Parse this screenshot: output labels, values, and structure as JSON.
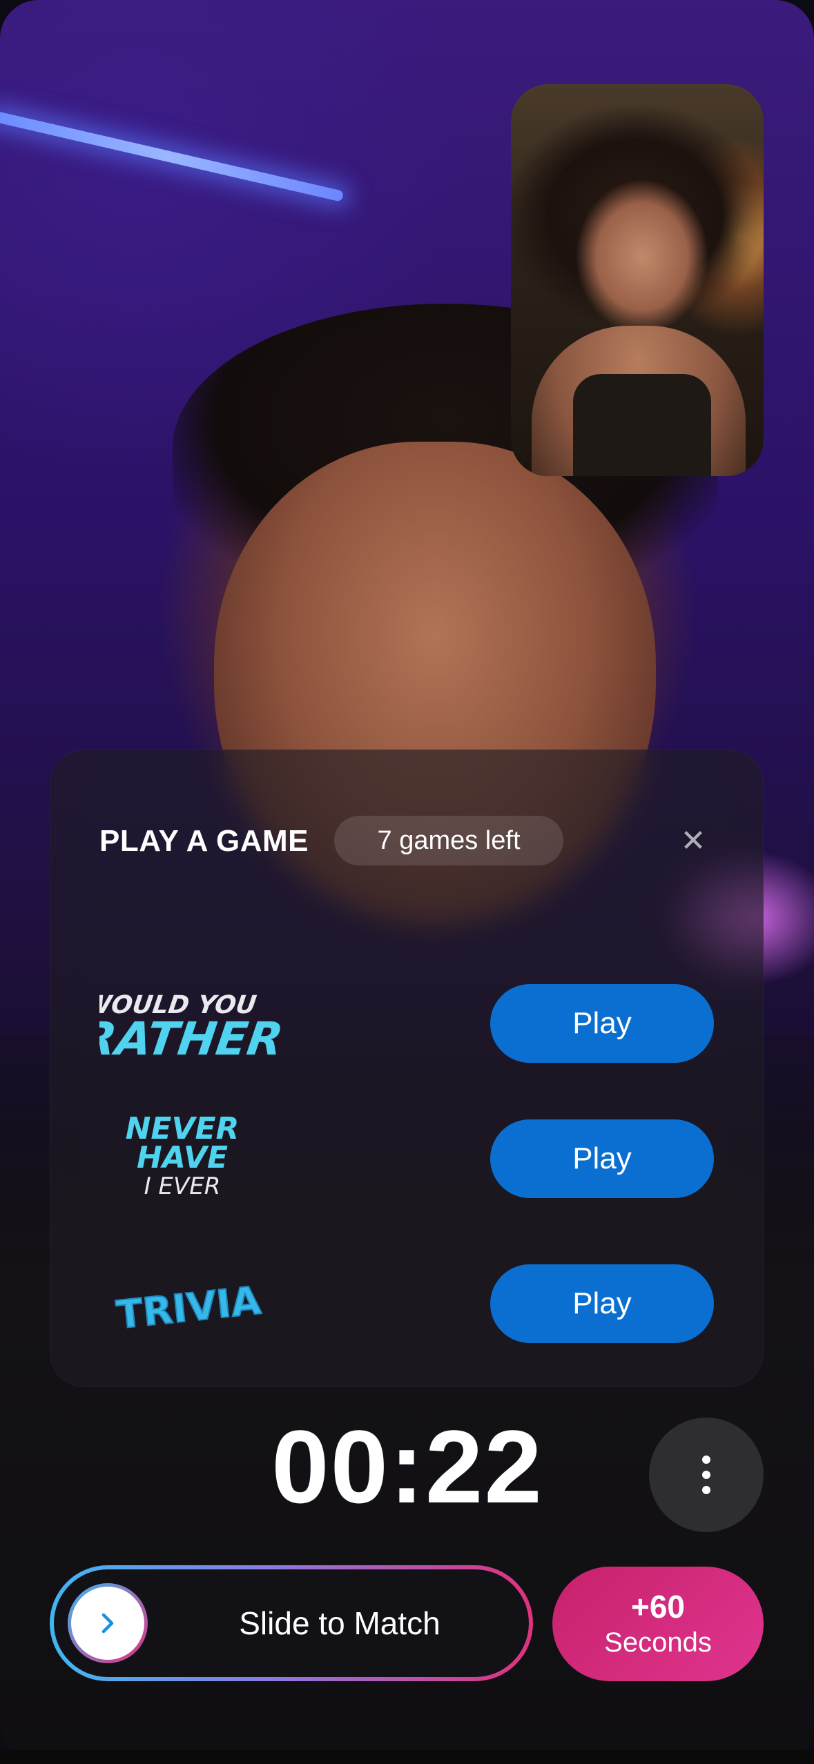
{
  "game_panel": {
    "title": "PLAY A GAME",
    "games_left": "7 games left",
    "close_icon": "close-icon",
    "games": [
      {
        "logo_lines": [
          "WOULD YOU",
          "RATHER"
        ],
        "play_label": "Play"
      },
      {
        "logo_lines": [
          "NEVER",
          "HAVE",
          "I EVER"
        ],
        "play_label": "Play"
      },
      {
        "logo_lines": [
          "TRIVIA"
        ],
        "play_label": "Play"
      }
    ]
  },
  "call": {
    "timer": "00:22",
    "more_icon": "more-vertical-icon"
  },
  "actions": {
    "slide_label": "Slide to Match",
    "slide_icon": "chevron-right-icon",
    "extend_amount": "+60",
    "extend_unit": "Seconds"
  },
  "colors": {
    "play_button": "#0a6fd1",
    "extend_button": "#d92b82",
    "logo_cyan": "#4fd3ee",
    "gradient_start": "#3fb6f2",
    "gradient_end": "#e0317f"
  }
}
